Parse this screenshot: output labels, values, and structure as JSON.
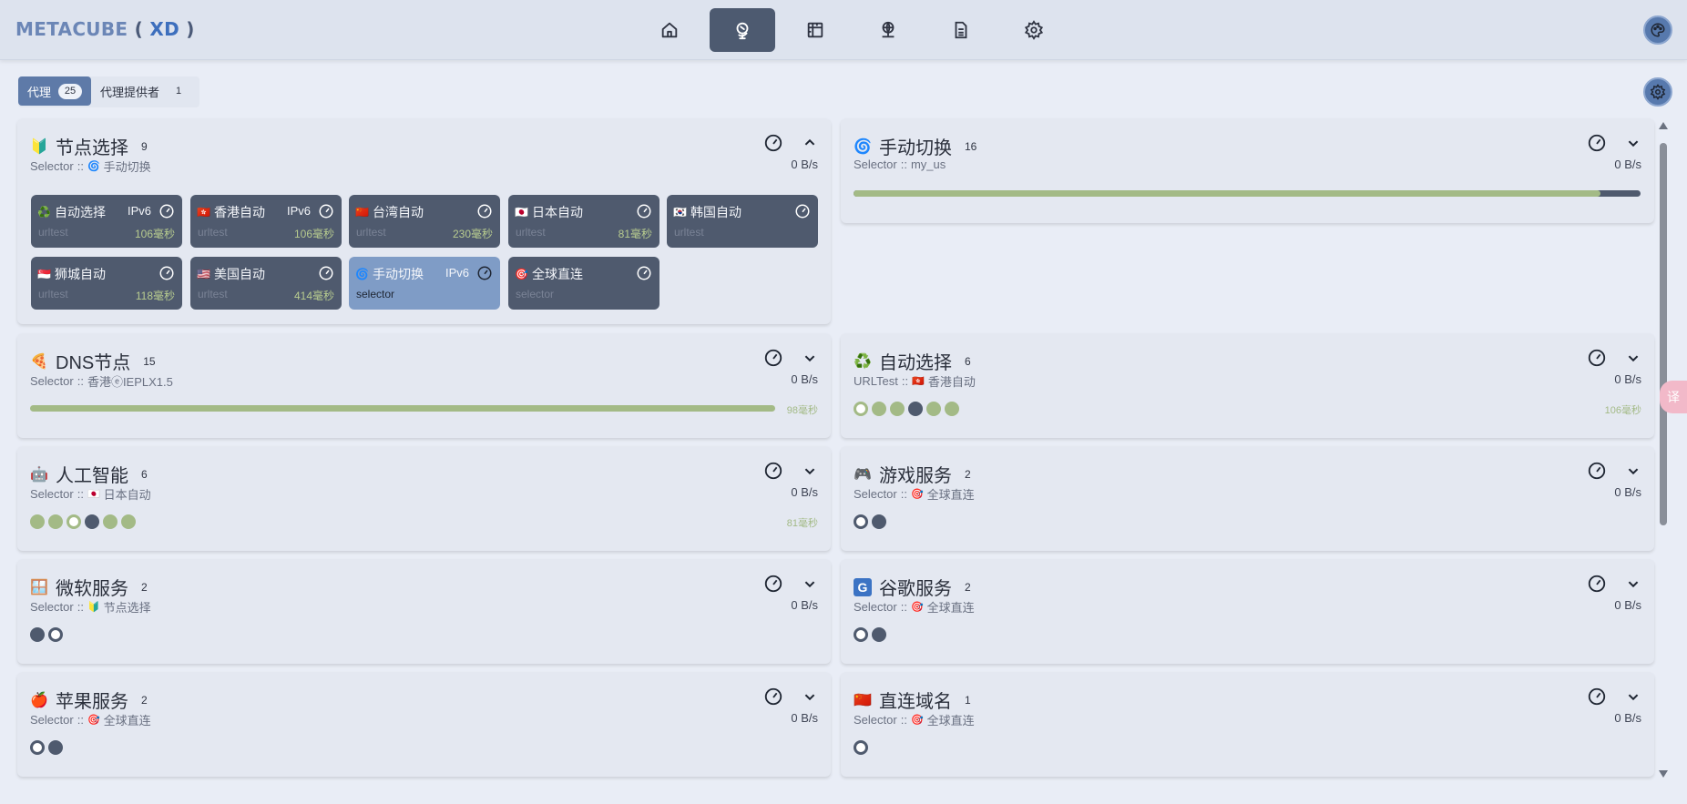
{
  "brand": {
    "name": "METACUBE",
    "open": "(",
    "xd": "XD",
    "close": ")"
  },
  "nav": {
    "tabs": [
      {
        "name": "home-icon",
        "active": false
      },
      {
        "name": "globe-stand-icon",
        "active": true
      },
      {
        "name": "ruler-icon",
        "active": false
      },
      {
        "name": "network-globe-icon",
        "active": false
      },
      {
        "name": "document-icon",
        "active": false
      },
      {
        "name": "gear-icon",
        "active": false
      }
    ],
    "theme_icon": "palette-icon"
  },
  "subtabs": [
    {
      "label": "代理",
      "count": "25",
      "active": true
    },
    {
      "label": "代理提供者",
      "count": "1",
      "active": false
    }
  ],
  "colors": {
    "accent": "#5e7aa8",
    "tile": "#4f5a6e",
    "tile_selected": "#7f9cc6",
    "latency_green": "#a3ba86"
  },
  "groups": {
    "g1": {
      "emoji": "🔰",
      "title": "节点选择",
      "count": "9",
      "type": "Selector",
      "sep": "::",
      "now_icon": "🌀",
      "now": "手动切换",
      "speed": "0 B/s"
    },
    "g2": {
      "emoji": "🌀",
      "title": "手动切换",
      "count": "16",
      "type": "Selector",
      "sep": "::",
      "now_icon": "",
      "now": "my_us",
      "speed": "0 B/s",
      "latency_fill": 0.95
    },
    "g3": {
      "emoji": "🍕",
      "title": "DNS节点",
      "count": "15",
      "type": "Selector",
      "sep": "::",
      "now_icon": "",
      "now": "香港ⓔIEPLX1.5",
      "speed": "0 B/s",
      "latency": "98毫秒"
    },
    "g4": {
      "emoji": "♻️",
      "title": "自动选择",
      "count": "6",
      "type": "URLTest",
      "sep": "::",
      "now_icon": "🇭🇰",
      "now": "香港自动",
      "speed": "0 B/s",
      "latency": "106毫秒"
    },
    "g5": {
      "emoji": "🤖",
      "title": "人工智能",
      "count": "6",
      "type": "Selector",
      "sep": "::",
      "now_icon": "🇯🇵",
      "now": "日本自动",
      "speed": "0 B/s",
      "latency": "81毫秒"
    },
    "g6": {
      "emoji": "🎮",
      "title": "游戏服务",
      "count": "2",
      "type": "Selector",
      "sep": "::",
      "now_icon": "🎯",
      "now": "全球直连",
      "speed": "0 B/s"
    },
    "g7": {
      "emoji": "🪟",
      "title": "微软服务",
      "count": "2",
      "type": "Selector",
      "sep": "::",
      "now_icon": "🔰",
      "now": "节点选择",
      "speed": "0 B/s"
    },
    "g8": {
      "emoji": "G",
      "title": "谷歌服务",
      "count": "2",
      "type": "Selector",
      "sep": "::",
      "now_icon": "🎯",
      "now": "全球直连",
      "speed": "0 B/s"
    },
    "g9": {
      "emoji": "🍎",
      "title": "苹果服务",
      "count": "2",
      "type": "Selector",
      "sep": "::",
      "now_icon": "🎯",
      "now": "全球直连",
      "speed": "0 B/s"
    },
    "g10": {
      "emoji": "🇨🇳",
      "title": "直连域名",
      "count": "1",
      "type": "Selector",
      "sep": "::",
      "now_icon": "🎯",
      "now": "全球直连",
      "speed": "0 B/s"
    }
  },
  "tiles": [
    {
      "flag": "♻️",
      "name": "自动选择",
      "ipv6": "IPv6",
      "type": "urltest",
      "latency": "106毫秒"
    },
    {
      "flag": "🇭🇰",
      "name": "香港自动",
      "ipv6": "IPv6",
      "type": "urltest",
      "latency": "106毫秒"
    },
    {
      "flag": "🇨🇳",
      "name": "台湾自动",
      "ipv6": "",
      "type": "urltest",
      "latency": "230毫秒"
    },
    {
      "flag": "🇯🇵",
      "name": "日本自动",
      "ipv6": "",
      "type": "urltest",
      "latency": "81毫秒"
    },
    {
      "flag": "🇰🇷",
      "name": "韩国自动",
      "ipv6": "",
      "type": "urltest",
      "latency": ""
    },
    {
      "flag": "🇸🇬",
      "name": "狮城自动",
      "ipv6": "",
      "type": "urltest",
      "latency": "118毫秒"
    },
    {
      "flag": "🇺🇸",
      "name": "美国自动",
      "ipv6": "",
      "type": "urltest",
      "latency": "414毫秒"
    },
    {
      "flag": "🌀",
      "name": "手动切换",
      "ipv6": "IPv6",
      "type": "selector",
      "latency": "",
      "selected": true
    },
    {
      "flag": "🎯",
      "name": "全球直连",
      "ipv6": "",
      "type": "selector",
      "latency": ""
    }
  ],
  "translate_label": "译"
}
